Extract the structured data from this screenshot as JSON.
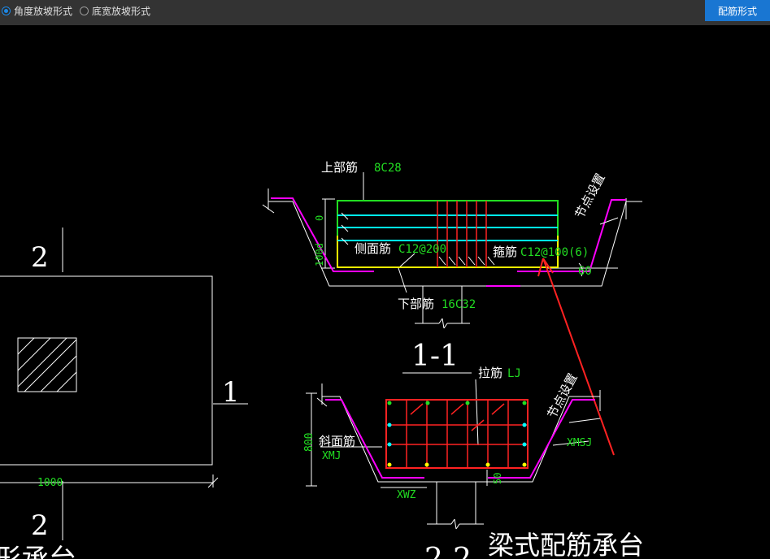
{
  "toolbar": {
    "option_angle": "角度放坡形式",
    "option_width": "底宽放坡形式",
    "selected": "option_angle",
    "button": "配筋形式"
  },
  "colors": {
    "accent": "#1976d2",
    "rebar_green": "#22dd22",
    "stirrup_red": "#ff2222",
    "cover_magenta": "#ff00ff",
    "tie_cyan": "#00ffff",
    "bottom_yellow": "#ffff00"
  },
  "plan": {
    "mark_top": "2",
    "mark_bottom": "2",
    "mark_right": "1",
    "dim_width": "1000",
    "partial_title": "形承台"
  },
  "section_1_1": {
    "top_rebar_label": "上部筋",
    "top_rebar_value": "8C28",
    "side_rebar_label": "侧面筋",
    "side_rebar_value": "C12@200",
    "stirrup_label": "箍筋",
    "stirrup_value": "C12@100(6)",
    "bottom_rebar_label": "下部筋",
    "bottom_rebar_value": "16C32",
    "node_setting": "节点设置",
    "angle": "60",
    "dim_0": "0",
    "dim_100d": "100d",
    "title": "1-1"
  },
  "section_2_2": {
    "tie_label": "拉筋",
    "tie_value": "LJ",
    "slope_rebar_label": "斜面筋",
    "slope_rebar_value": "XMJ",
    "xmsj": "XMSJ",
    "xwz": "XWZ",
    "dim_800": "800",
    "dim_50": "50",
    "node_setting": "节点设置",
    "title": "2-2"
  },
  "caption": "梁式配筋承台"
}
